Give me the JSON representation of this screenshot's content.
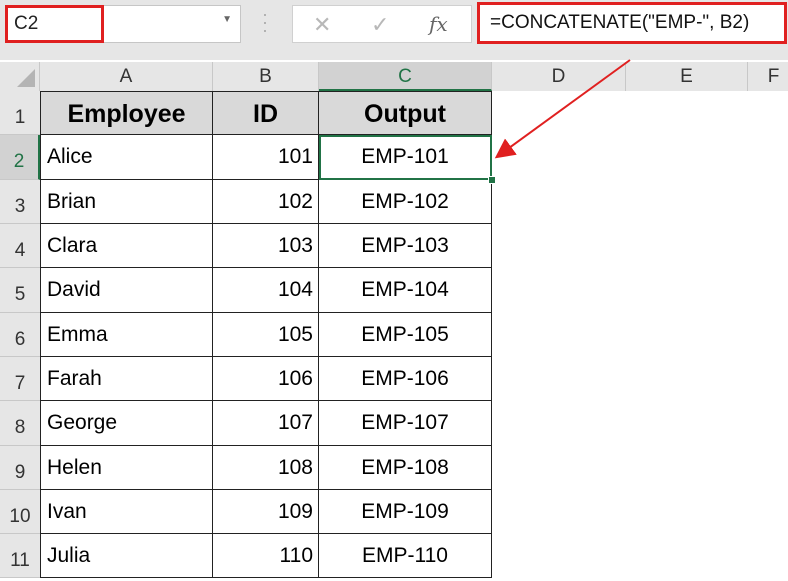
{
  "name_box": "C2",
  "formula": "=CONCATENATE(\"EMP-\", B2)",
  "formula_buttons": {
    "cancel": "✕",
    "enter": "✓",
    "fx": "fx"
  },
  "columns": [
    "A",
    "B",
    "C",
    "D",
    "E",
    "F"
  ],
  "headers": [
    "Employee",
    "ID",
    "Output"
  ],
  "rows": [
    [
      "Alice",
      "101",
      "EMP-101"
    ],
    [
      "Brian",
      "102",
      "EMP-102"
    ],
    [
      "Clara",
      "103",
      "EMP-103"
    ],
    [
      "David",
      "104",
      "EMP-104"
    ],
    [
      "Emma",
      "105",
      "EMP-105"
    ],
    [
      "Farah",
      "106",
      "EMP-106"
    ],
    [
      "George",
      "107",
      "EMP-107"
    ],
    [
      "Helen",
      "108",
      "EMP-108"
    ],
    [
      "Ivan",
      "109",
      "EMP-109"
    ],
    [
      "Julia",
      "110",
      "EMP-110"
    ]
  ],
  "row_numbers": [
    "1",
    "2",
    "3",
    "4",
    "5",
    "6",
    "7",
    "8",
    "9",
    "10",
    "11"
  ],
  "colors": {
    "highlight": "#e02020",
    "selection": "#217346"
  }
}
